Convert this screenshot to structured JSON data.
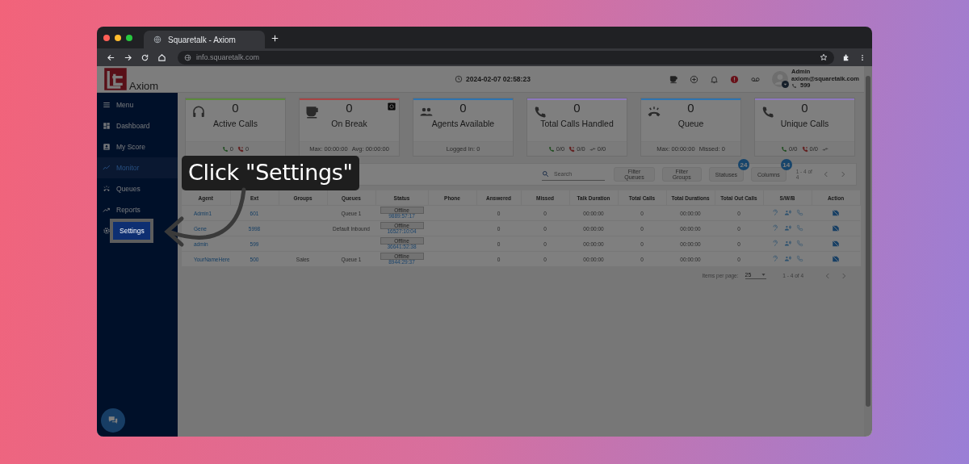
{
  "browser": {
    "tab_title": "Squaretalk - Axiom",
    "url": "info.squaretalk.com"
  },
  "header": {
    "logo_text": "Axiom",
    "datetime": "2024-02-07 02:58:23",
    "user": {
      "name": "Admin",
      "email": "axiom@squaretalk.com",
      "extension": "599"
    }
  },
  "sidebar": {
    "items": [
      {
        "label": "Menu",
        "kind": "menu",
        "selected": false,
        "spotlight": false
      },
      {
        "label": "Dashboard",
        "kind": "dashboard",
        "selected": false,
        "spotlight": false
      },
      {
        "label": "My Score",
        "kind": "score",
        "selected": false,
        "spotlight": false
      },
      {
        "label": "Monitor",
        "kind": "monitor",
        "selected": true,
        "spotlight": false
      },
      {
        "label": "Queues",
        "kind": "queues",
        "selected": false,
        "spotlight": false
      },
      {
        "label": "Reports",
        "kind": "reports",
        "selected": false,
        "spotlight": false
      },
      {
        "label": "Settings",
        "kind": "settings",
        "selected": false,
        "spotlight": true
      }
    ]
  },
  "cards": [
    {
      "kind": "headset",
      "value": "0",
      "label": "Active Calls",
      "color": "#5b8a3c",
      "footer": [
        {
          "kind": "answered",
          "text": "0"
        },
        {
          "kind": "missed",
          "text": "0"
        }
      ]
    },
    {
      "kind": "coffee",
      "value": "0",
      "label": "On Break",
      "color": "#a84444",
      "footer": [
        {
          "kind": "text",
          "text": "Max: 00:00:00"
        },
        {
          "kind": "text",
          "text": "Avg: 00:00:00"
        }
      ]
    },
    {
      "kind": "agents",
      "value": "0",
      "label": "Agents Available",
      "color": "#2e74b0",
      "footer": [
        {
          "kind": "text",
          "text": "Logged In: 0"
        }
      ]
    },
    {
      "kind": "phone",
      "value": "0",
      "label": "Total Calls Handled",
      "color": "#8e78bf",
      "footer": [
        {
          "kind": "answered",
          "text": "0/0"
        },
        {
          "kind": "missed",
          "text": "0/0"
        },
        {
          "kind": "transfer",
          "text": "0/0"
        }
      ]
    },
    {
      "kind": "hangup",
      "value": "0",
      "label": "Queue",
      "color": "#2e74b0",
      "footer": [
        {
          "kind": "text",
          "text": "Max:  00:00:00"
        },
        {
          "kind": "text",
          "text": "Missed:  0"
        }
      ]
    },
    {
      "kind": "phone",
      "value": "0",
      "label": "Unique Calls",
      "color": "#8e78bf",
      "footer": [
        {
          "kind": "answered",
          "text": "0/0"
        },
        {
          "kind": "missed",
          "text": "0/0"
        },
        {
          "kind": "transfer"
        }
      ]
    }
  ],
  "toolbar": {
    "search_placeholder": "Search",
    "buttons": [
      {
        "label": "Filter Queues"
      },
      {
        "label": "Filter Groups"
      },
      {
        "label": "Statuses",
        "badge": "24"
      },
      {
        "label": "Columns",
        "badge": "14"
      }
    ],
    "range": "1 - 4 of 4"
  },
  "table": {
    "columns": [
      "Agent",
      "Ext",
      "Groups",
      "Queues",
      "Status",
      "Phone",
      "Answered",
      "Missed",
      "Talk Duration",
      "Total Calls",
      "Total Durations",
      "Total Out Calls",
      "S/W/B",
      "Action"
    ],
    "rows": [
      {
        "agent": "Admin1",
        "ext": "601",
        "queues": "Queue 1",
        "status": "Offline",
        "status_time": "9889:57:17",
        "answered": "0",
        "missed": "0",
        "talk_duration": "00:00:00",
        "total_calls": "0",
        "total_durations": "00:00:00",
        "total_out_calls": "0"
      },
      {
        "agent": "Gene",
        "ext": "5998",
        "queues": "Default Inbound",
        "status": "Offline",
        "status_time": "16527:10:04",
        "answered": "0",
        "missed": "0",
        "talk_duration": "00:00:00",
        "total_calls": "0",
        "total_durations": "00:00:00",
        "total_out_calls": "0"
      },
      {
        "agent": "admin",
        "ext": "599",
        "status": "Offline",
        "status_time": "36641:52:38",
        "answered": "0",
        "missed": "0",
        "talk_duration": "00:00:00",
        "total_calls": "0",
        "total_durations": "00:00:00",
        "total_out_calls": "0"
      },
      {
        "agent": "YourNameHere",
        "ext": "500",
        "groups": "Sales",
        "queues": "Queue 1",
        "status": "Offline",
        "status_time": "8944:29:37",
        "answered": "0",
        "missed": "0",
        "talk_duration": "00:00:00",
        "total_calls": "0",
        "total_durations": "00:00:00",
        "total_out_calls": "0"
      }
    ]
  },
  "pagination": {
    "label": "Items per page:",
    "page_size": "25",
    "range": "1 - 4 of 4"
  },
  "tour": {
    "callout": "Click \"Settings\""
  }
}
